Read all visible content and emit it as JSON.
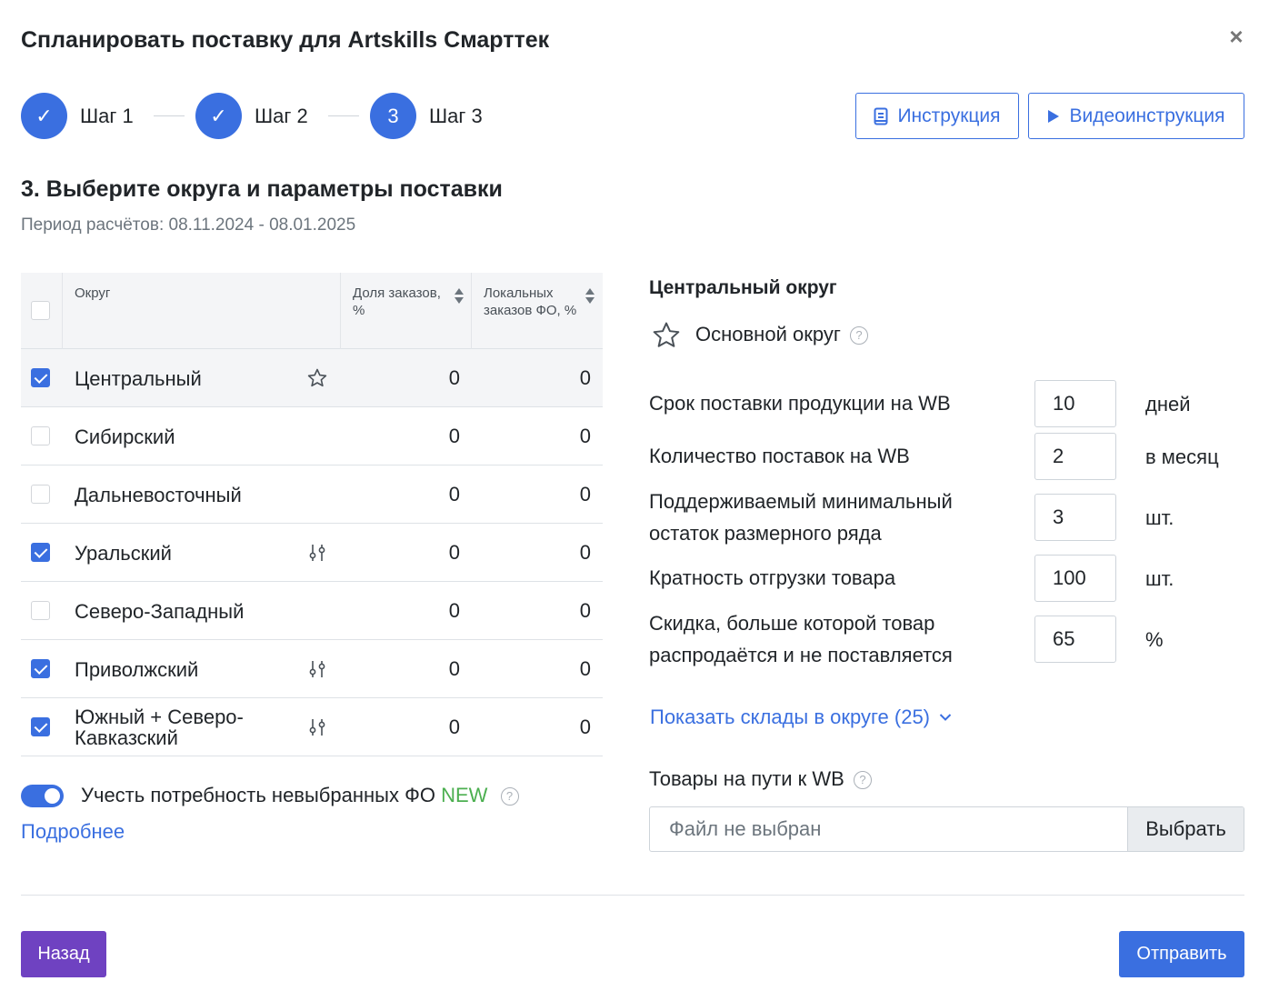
{
  "modal": {
    "title": "Спланировать поставку для Artskills Смарттек",
    "close_icon": "close-icon"
  },
  "stepper": {
    "steps": [
      {
        "label": "Шаг 1",
        "state": "done",
        "marker": "✓"
      },
      {
        "label": "Шаг 2",
        "state": "done",
        "marker": "✓"
      },
      {
        "label": "Шаг 3",
        "state": "current",
        "marker": "3"
      }
    ]
  },
  "toolbar": {
    "instruction_label": "Инструкция",
    "video_label": "Видеоинструкция"
  },
  "section": {
    "title": "3. Выберите округа и параметры поставки",
    "period": "Период расчётов: 08.11.2024 - 08.01.2025"
  },
  "table": {
    "headers": {
      "district": "Округ",
      "share": "Доля заказов, %",
      "local": "Локальных заказов ФО, %"
    },
    "rows": [
      {
        "name": "Центральный",
        "checked": true,
        "icon": "star-icon",
        "share": "0",
        "local": "0"
      },
      {
        "name": "Сибирский",
        "checked": false,
        "icon": "",
        "share": "0",
        "local": "0"
      },
      {
        "name": "Дальневосточный",
        "checked": false,
        "icon": "",
        "share": "0",
        "local": "0"
      },
      {
        "name": "Уральский",
        "checked": true,
        "icon": "sliders-icon",
        "share": "0",
        "local": "0"
      },
      {
        "name": "Северо-Западный",
        "checked": false,
        "icon": "",
        "share": "0",
        "local": "0"
      },
      {
        "name": "Приволжский",
        "checked": true,
        "icon": "sliders-icon",
        "share": "0",
        "local": "0"
      },
      {
        "name": "Южный + Северо-Кавказский",
        "checked": true,
        "icon": "sliders-icon",
        "share": "0",
        "local": "0"
      }
    ]
  },
  "toggle": {
    "on": true,
    "label": "Учесть потребность невыбранных ФО",
    "badge": "NEW",
    "more_link": "Подробнее"
  },
  "district_panel": {
    "title": "Центральный округ",
    "main_label": "Основной округ",
    "params": [
      {
        "label_lines": [
          "Срок поставки продукции на WB"
        ],
        "value": "10",
        "unit": "дней"
      },
      {
        "label_lines": [
          "Количество поставок на WB"
        ],
        "value": "2",
        "unit": "в месяц"
      },
      {
        "label_lines": [
          "Поддерживаемый минимальный",
          "остаток размерного ряда"
        ],
        "value": "3",
        "unit": "шт."
      },
      {
        "label_lines": [
          "Кратность отгрузки товара"
        ],
        "value": "100",
        "unit": "шт."
      },
      {
        "label_lines": [
          "Скидка, больше которой товар",
          "распродаётся и не поставляется"
        ],
        "value": "65",
        "unit": "%"
      }
    ],
    "show_warehouses": "Показать склады в округе (25)",
    "goods_label": "Товары на пути к WB",
    "file_placeholder": "Файл не выбран",
    "file_button": "Выбрать"
  },
  "footer": {
    "back_label": "Назад",
    "send_label": "Отправить"
  },
  "colors": {
    "accent": "#3a6fe0",
    "back_button": "#6f42c1",
    "new_badge": "#4caf50"
  }
}
